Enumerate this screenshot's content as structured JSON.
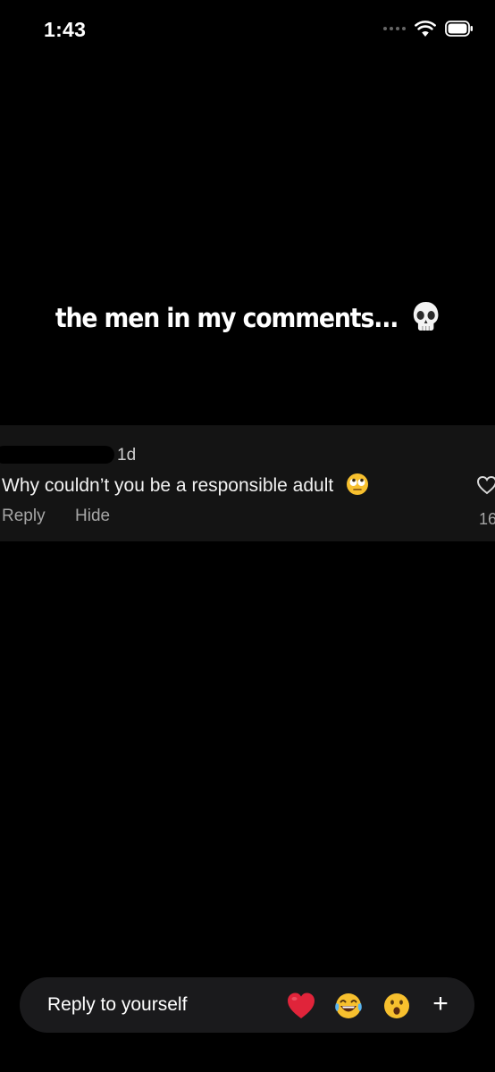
{
  "status_bar": {
    "time": "1:43",
    "icons": [
      "signal-dots-icon",
      "wifi-icon",
      "battery-icon"
    ]
  },
  "story": {
    "caption": "the men in my comments...",
    "caption_emoji": "skull-icon"
  },
  "comment": {
    "time": "1d",
    "text": "Why couldn’t you be a responsible adult",
    "text_emoji": "eye-roll-face-icon",
    "reply_label": "Reply",
    "hide_label": "Hide",
    "like_count": "16"
  },
  "reply_bar": {
    "placeholder": "Reply to yourself",
    "reactions": [
      "heart-icon",
      "laughing-face-icon",
      "surprised-face-icon"
    ],
    "plus_label": "+"
  },
  "colors": {
    "background": "#000000",
    "card": "#141414",
    "muted_text": "#a6a6a6",
    "reply_bar": "#1a1a1c",
    "heart_red": "#e0243a",
    "emoji_yellow": "#f7c02e"
  }
}
